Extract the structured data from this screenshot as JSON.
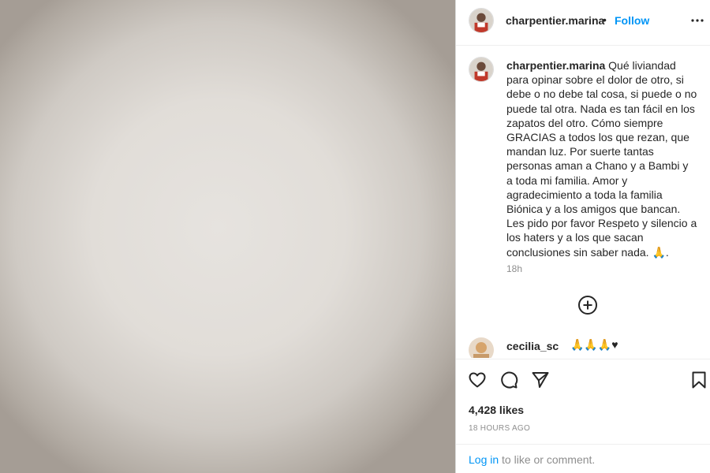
{
  "post": {
    "username": "charpentier.marina",
    "separator": "•",
    "follow_label": "Follow",
    "more_icon": "more-horizontal-icon"
  },
  "caption": {
    "username": "charpentier.marina",
    "text": "Qué liviandad para opinar sobre el dolor de otro, si debe o no debe tal cosa, si puede o no puede tal otra. Nada es tan fácil en los zapatos del otro. Cómo siempre GRACIAS a todos los que rezan, que mandan luz. Por suerte tantas personas aman a Chano y a Bambi y a toda mi familia. Amor y agradecimiento a toda la familia Biónica y a los amigos que bancan. Les pido por favor Respeto y silencio a los haters y a los que sacan conclusiones sin saber nada. 🙏.",
    "time": "18h"
  },
  "comment": {
    "username": "cecilia_sc",
    "text": "🙏🙏🙏♥"
  },
  "actions": {
    "like_icon": "heart-icon",
    "comment_icon": "comment-icon",
    "share_icon": "send-icon",
    "save_icon": "bookmark-icon",
    "add_icon": "plus-circle-icon"
  },
  "likes": "4,428 likes",
  "posted_ago": "18 HOURS AGO",
  "login": {
    "link_label": "Log in",
    "rest_text": " to like or comment."
  },
  "colors": {
    "accent": "#0095f6",
    "secondary_text": "#8e8e8e",
    "primary_text": "#262626"
  }
}
